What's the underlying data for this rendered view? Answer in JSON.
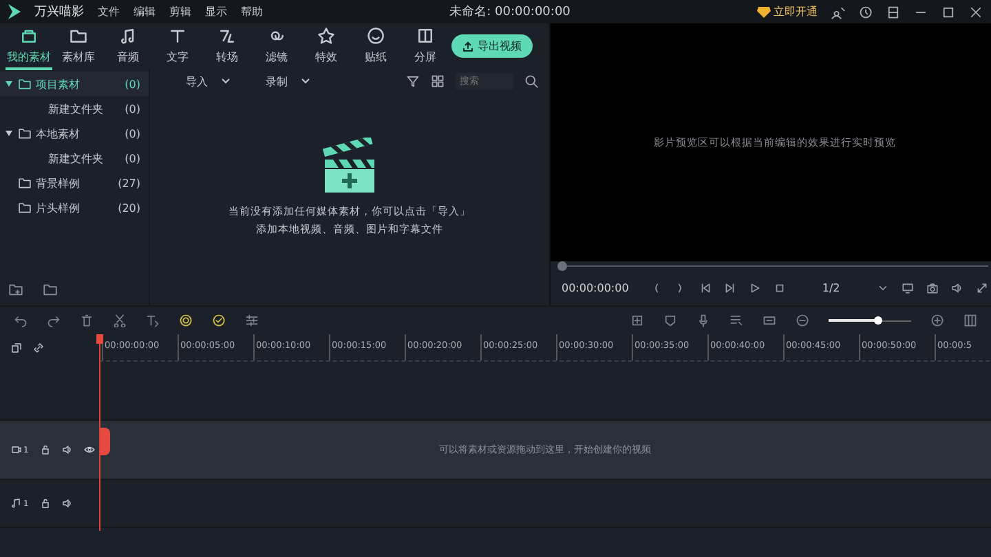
{
  "window": {
    "app_name": "万兴喵影",
    "menu": [
      "文件",
      "编辑",
      "剪辑",
      "显示",
      "帮助"
    ],
    "title": "未命名: 00:00:00:00",
    "vip_button": "立即开通"
  },
  "tabs": [
    {
      "label": "我的素材",
      "kind": "media",
      "selected": true
    },
    {
      "label": "素材库",
      "kind": "library",
      "selected": false
    },
    {
      "label": "音频",
      "kind": "audio",
      "selected": false
    },
    {
      "label": "文字",
      "kind": "text",
      "selected": false
    },
    {
      "label": "转场",
      "kind": "transition",
      "selected": false
    },
    {
      "label": "滤镜",
      "kind": "filter",
      "selected": false
    },
    {
      "label": "特效",
      "kind": "effect",
      "selected": false
    },
    {
      "label": "贴纸",
      "kind": "sticker",
      "selected": false
    },
    {
      "label": "分屏",
      "kind": "split",
      "selected": false
    }
  ],
  "export_button": "导出视频",
  "sidebar": {
    "items": [
      {
        "label": "项目素材",
        "count": "(0)",
        "selected": true,
        "expanded": true,
        "children": [
          {
            "label": "新建文件夹",
            "count": "(0)",
            "selected": false
          }
        ]
      },
      {
        "label": "本地素材",
        "count": "(0)",
        "selected": false,
        "expanded": true,
        "children": [
          {
            "label": "新建文件夹",
            "count": "(0)",
            "selected": false
          }
        ]
      },
      {
        "label": "背景样例",
        "count": "(27)",
        "selected": false,
        "expanded": false
      },
      {
        "label": "片头样例",
        "count": "(20)",
        "selected": false,
        "expanded": false
      }
    ]
  },
  "media": {
    "dropdowns": [
      "导入",
      "录制"
    ],
    "search": {
      "placeholder": "搜索"
    },
    "empty_message": [
      "当前没有添加任何媒体素材，你可以点击「导入」",
      "添加本地视频、音频、图片和字幕文件"
    ]
  },
  "preview": {
    "message": "影片预览区可以根据当前编辑的效果进行实时预览",
    "progress": {
      "level": 0
    },
    "timecode": "00:00:00:00",
    "speed": "1/2"
  },
  "timeline": {
    "zoom": {
      "level": 0.6
    },
    "ruler": [
      "00:00:00:00",
      "00:00:05:00",
      "00:00:10:00",
      "00:00:15:00",
      "00:00:20:00",
      "00:00:25:00",
      "00:00:30:00",
      "00:00:35:00",
      "00:00:40:00",
      "00:00:45:00",
      "00:00:50:00",
      "00:00:5"
    ],
    "tracks": [
      {
        "kind": "video",
        "number": "1",
        "hint": "可以将素材或资源拖动到这里，开始创建你的视频"
      },
      {
        "kind": "audio",
        "number": "1"
      }
    ]
  }
}
